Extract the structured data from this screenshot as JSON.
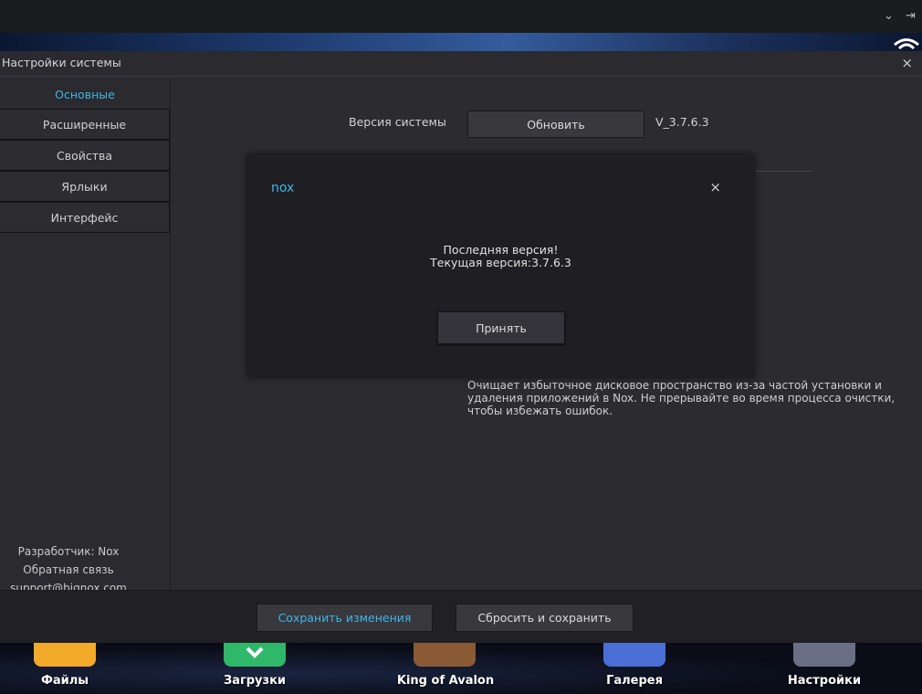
{
  "settings": {
    "title": "Настройки системы",
    "close": "×"
  },
  "sidebar": {
    "items": [
      {
        "label": "Основные"
      },
      {
        "label": "Расширенные"
      },
      {
        "label": "Свойства"
      },
      {
        "label": "Ярлыки"
      },
      {
        "label": "Интерфейс"
      }
    ],
    "developer": "Разработчик: Nox",
    "feedback": "Обратная связь",
    "email": "support@bignox.com"
  },
  "general": {
    "system_version_label": "Версия системы",
    "update_button": "Обновить",
    "version_value": "V_3.7.6.3",
    "clean_description": "Очищает избыточное дисковое пространство из-за частой установки и удаления приложений в Nox. Не прерывайте во время процесса очистки, чтобы избежать ошибок."
  },
  "footer": {
    "save_button": "Сохранить изменения",
    "reset_button": "Сбросить и сохранить"
  },
  "dialog": {
    "logo": "nox",
    "close": "×",
    "message_line1": "Последняя версия!",
    "message_line2": "Текущая версия:3.7.6.3",
    "accept_button": "Принять"
  },
  "dock": {
    "apps": [
      {
        "label": "Файлы",
        "icon": "folder-icon",
        "color": "#f3a92a"
      },
      {
        "label": "Загрузки",
        "icon": "download-icon",
        "color": "#2fb86a"
      },
      {
        "label": "King of Avalon",
        "icon": "game-icon",
        "color": "#8a5a34"
      },
      {
        "label": "Галерея",
        "icon": "gallery-icon",
        "color": "#4a6fd6"
      },
      {
        "label": "Настройки",
        "icon": "settings-icon",
        "color": "#6a6f86"
      }
    ]
  },
  "colors": {
    "accent": "#3fb6e8",
    "panel": "#2b2b30",
    "dialog": "#1e1e23"
  }
}
